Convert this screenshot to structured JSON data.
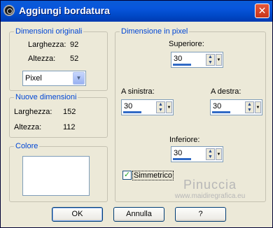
{
  "window": {
    "title": "Aggiungi bordatura",
    "close_glyph": "✕"
  },
  "original_dims": {
    "label": "Dimensioni originali",
    "width_label": "Larghezza:",
    "width_value": "92",
    "height_label": "Altezza:",
    "height_value": "52",
    "unit": "Pixel"
  },
  "new_dims": {
    "label": "Nuove dimensioni",
    "width_label": "Larghezza:",
    "width_value": "152",
    "height_label": "Altezza:",
    "height_value": "112"
  },
  "color": {
    "label": "Colore"
  },
  "pixel_dims": {
    "label": "Dimensione in pixel",
    "top_label": "Superiore:",
    "top_value": "30",
    "left_label": "A sinistra:",
    "left_value": "30",
    "right_label": "A destra:",
    "right_value": "30",
    "bottom_label": "Inferiore:",
    "bottom_value": "30",
    "symmetric_label": "Simmetrico",
    "symmetric_checked": true
  },
  "watermark": {
    "line1": "Pinuccia",
    "line2": "www.maidiregrafica.eu"
  },
  "buttons": {
    "ok": "OK",
    "cancel": "Annulla",
    "help": "?"
  },
  "colors": {
    "title_bar": "#0054e3",
    "group_label": "#0046d5",
    "dialog_bg": "#ece9d8"
  }
}
